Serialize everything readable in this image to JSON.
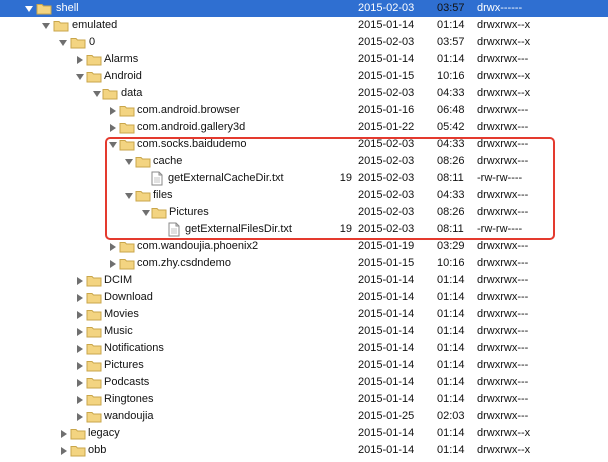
{
  "rows": [
    {
      "name": "shell",
      "date": "2015-02-03",
      "time": "03:57",
      "perm": "drwx------",
      "size": "",
      "selected": true
    },
    {
      "name": "emulated",
      "date": "2015-01-14",
      "time": "01:14",
      "perm": "drwxrwx--x",
      "size": ""
    },
    {
      "name": "0",
      "date": "2015-02-03",
      "time": "03:57",
      "perm": "drwxrwx--x",
      "size": ""
    },
    {
      "name": "Alarms",
      "date": "2015-01-14",
      "time": "01:14",
      "perm": "drwxrwx---",
      "size": ""
    },
    {
      "name": "Android",
      "date": "2015-01-15",
      "time": "10:16",
      "perm": "drwxrwx--x",
      "size": ""
    },
    {
      "name": "data",
      "date": "2015-02-03",
      "time": "04:33",
      "perm": "drwxrwx--x",
      "size": ""
    },
    {
      "name": "com.android.browser",
      "date": "2015-01-16",
      "time": "06:48",
      "perm": "drwxrwx---",
      "size": ""
    },
    {
      "name": "com.android.gallery3d",
      "date": "2015-01-22",
      "time": "05:42",
      "perm": "drwxrwx---",
      "size": ""
    },
    {
      "name": "com.socks.baidudemo",
      "date": "2015-02-03",
      "time": "04:33",
      "perm": "drwxrwx---",
      "size": ""
    },
    {
      "name": "cache",
      "date": "2015-02-03",
      "time": "08:26",
      "perm": "drwxrwx---",
      "size": ""
    },
    {
      "name": "getExternalCacheDir.txt",
      "date": "2015-02-03",
      "time": "08:11",
      "perm": "-rw-rw----",
      "size": "19"
    },
    {
      "name": "files",
      "date": "2015-02-03",
      "time": "04:33",
      "perm": "drwxrwx---",
      "size": ""
    },
    {
      "name": "Pictures",
      "date": "2015-02-03",
      "time": "08:26",
      "perm": "drwxrwx---",
      "size": ""
    },
    {
      "name": "getExternalFilesDir.txt",
      "date": "2015-02-03",
      "time": "08:11",
      "perm": "-rw-rw----",
      "size": "19"
    },
    {
      "name": "com.wandoujia.phoenix2",
      "date": "2015-01-19",
      "time": "03:29",
      "perm": "drwxrwx---",
      "size": ""
    },
    {
      "name": "com.zhy.csdndemo",
      "date": "2015-01-15",
      "time": "10:16",
      "perm": "drwxrwx---",
      "size": ""
    },
    {
      "name": "DCIM",
      "date": "2015-01-14",
      "time": "01:14",
      "perm": "drwxrwx---",
      "size": ""
    },
    {
      "name": "Download",
      "date": "2015-01-14",
      "time": "01:14",
      "perm": "drwxrwx---",
      "size": ""
    },
    {
      "name": "Movies",
      "date": "2015-01-14",
      "time": "01:14",
      "perm": "drwxrwx---",
      "size": ""
    },
    {
      "name": "Music",
      "date": "2015-01-14",
      "time": "01:14",
      "perm": "drwxrwx---",
      "size": ""
    },
    {
      "name": "Notifications",
      "date": "2015-01-14",
      "time": "01:14",
      "perm": "drwxrwx---",
      "size": ""
    },
    {
      "name": "Pictures",
      "date": "2015-01-14",
      "time": "01:14",
      "perm": "drwxrwx---",
      "size": ""
    },
    {
      "name": "Podcasts",
      "date": "2015-01-14",
      "time": "01:14",
      "perm": "drwxrwx---",
      "size": ""
    },
    {
      "name": "Ringtones",
      "date": "2015-01-14",
      "time": "01:14",
      "perm": "drwxrwx---",
      "size": ""
    },
    {
      "name": "wandoujia",
      "date": "2015-01-25",
      "time": "02:03",
      "perm": "drwxrwx---",
      "size": ""
    },
    {
      "name": "legacy",
      "date": "2015-01-14",
      "time": "01:14",
      "perm": "drwxrwx--x",
      "size": ""
    },
    {
      "name": "obb",
      "date": "2015-01-14",
      "time": "01:14",
      "perm": "drwxrwx--x",
      "size": ""
    }
  ],
  "colors": {
    "selection": "#2f6fd1",
    "highlight_box": "#e43a2e",
    "folder_fill": "#f3d481",
    "folder_stroke": "#c9a64b"
  }
}
